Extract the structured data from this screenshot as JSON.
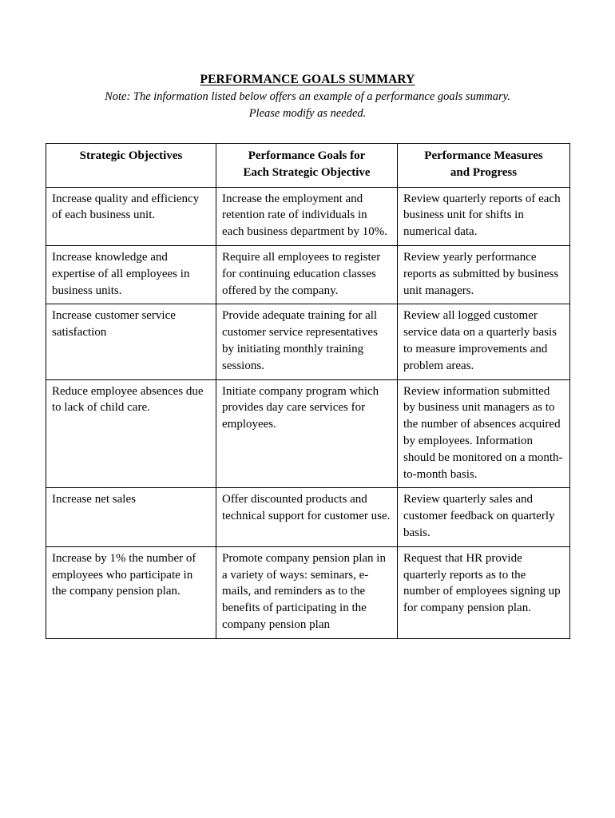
{
  "document": {
    "title": "PERFORMANCE GOALS SUMMARY",
    "note_line_1": "Note: The information listed below offers an example of a performance goals summary.",
    "note_line_2": "Please modify as needed.",
    "text_color": "#000000",
    "background_color": "#ffffff",
    "border_color": "#000000"
  },
  "table": {
    "headers": [
      "Strategic Objectives",
      "Performance Goals for Each Strategic Objective",
      "Performance Measures and Progress"
    ],
    "headers_lines": {
      "col1_line1": "Strategic Objectives",
      "col2_line1": "Performance Goals for",
      "col2_line2": "Each Strategic Objective",
      "col3_line1": "Performance Measures",
      "col3_line2": "and Progress"
    },
    "rows": [
      {
        "objective": "Increase quality and efficiency of each business unit.",
        "goal": "Increase the employment and retention rate of individuals in each business department by 10%.",
        "measure": "Review quarterly reports of each business unit for shifts in numerical data."
      },
      {
        "objective": "Increase knowledge and expertise of all employees in business units.",
        "goal": "Require all employees to register for continuing education classes offered by the company.",
        "measure": "Review yearly performance reports as submitted by business unit managers."
      },
      {
        "objective": "Increase customer service satisfaction",
        "goal": "Provide adequate training for all customer service representatives by initiating monthly training sessions.",
        "measure": "Review all logged customer service data on a quarterly basis to measure improvements and problem areas."
      },
      {
        "objective": "Reduce employee absences due to lack of child care.",
        "goal": "Initiate company program which provides day care services for employees.",
        "measure": "Review information submitted by business unit managers as to the number of absences acquired by employees. Information should be monitored on a month-to-month basis."
      },
      {
        "objective": "Increase net sales",
        "goal": "Offer discounted products and technical support for customer use.",
        "measure": "Review quarterly sales and customer feedback on quarterly basis."
      },
      {
        "objective": "Increase by 1% the number of employees who participate in the company pension plan.",
        "goal": "Promote company pension plan in a variety of ways: seminars, e-mails, and reminders as to the benefits of participating in the company pension plan",
        "measure": "Request that HR provide quarterly reports as to the number of employees signing up for company pension plan."
      }
    ]
  }
}
